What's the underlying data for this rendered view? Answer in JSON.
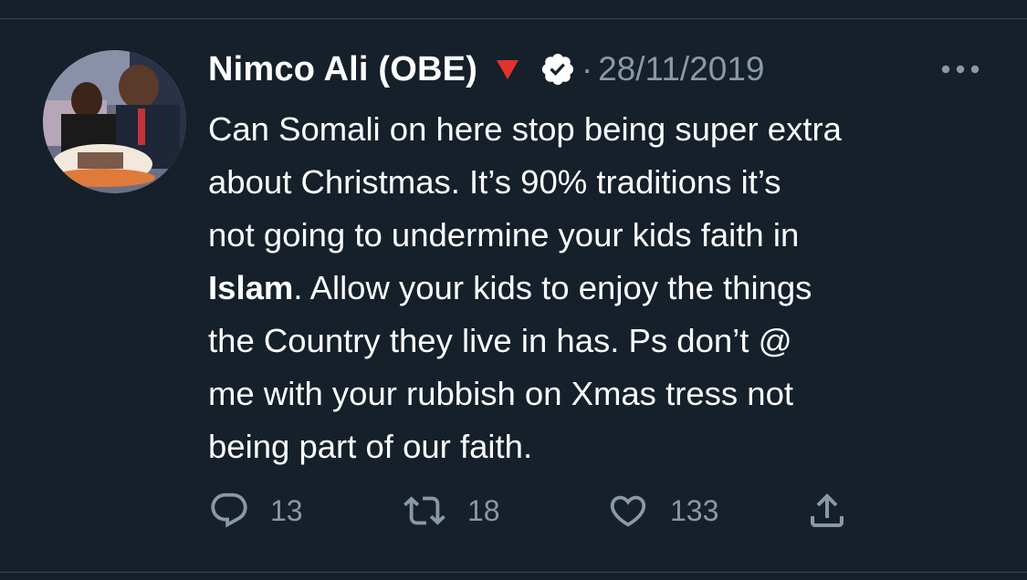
{
  "tweet": {
    "author_name": "Nimco Ali (OBE)",
    "separator": "·",
    "date": "28/11/2019",
    "body_lines": [
      "Can Somali on here stop being super extra",
      "about Christmas. It’s 90% traditions it’s",
      "not going to undermine your kids faith in"
    ],
    "bold_word": "Islam",
    "line4_rest": ". Allow your kids to enjoy the things",
    "body_lines_after": [
      "the Country they live in has. Ps don’t @",
      "me with your rubbish on Xmas tress not",
      "being part of our faith."
    ]
  },
  "actions": {
    "replies": "13",
    "retweets": "18",
    "likes": "133"
  },
  "icons": {
    "flag": "red-triangle-icon",
    "verified": "verified-badge-icon",
    "more": "more-options-icon",
    "reply": "reply-icon",
    "retweet": "retweet-icon",
    "like": "heart-icon",
    "share": "share-icon"
  },
  "colors": {
    "background": "#15202b",
    "text": "#ffffff",
    "secondary": "#8b98a5",
    "flag_red": "#e0332f"
  }
}
